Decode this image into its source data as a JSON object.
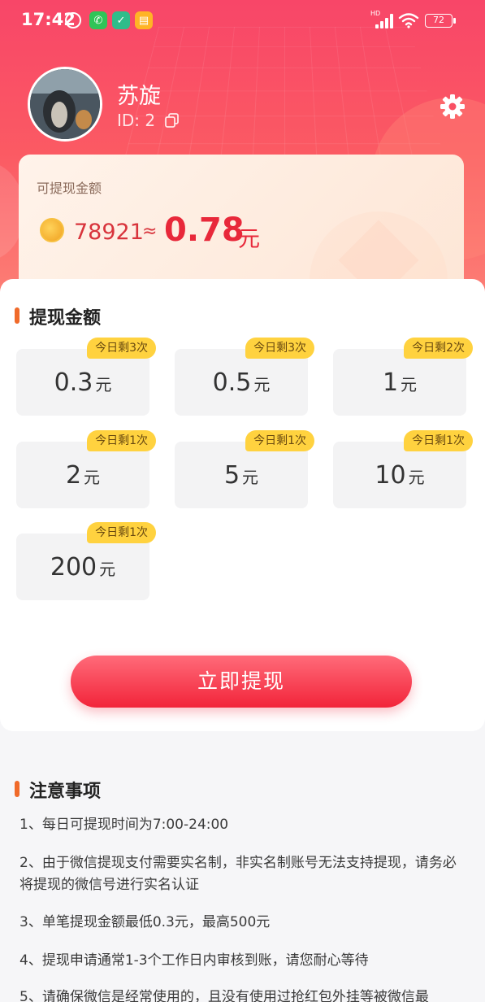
{
  "status_bar": {
    "time": "17:42",
    "network": "HD",
    "battery": "72"
  },
  "profile": {
    "name": "苏旋",
    "id_text": "ID: 2"
  },
  "balance": {
    "label": "可提现金额",
    "coins": "78921",
    "approx": "≈",
    "amount": "0.78",
    "unit": "元"
  },
  "withdraw_section": {
    "title": "提现金额",
    "unit": "元",
    "options": [
      {
        "amount": "0.3",
        "badge": "今日剩3次"
      },
      {
        "amount": "0.5",
        "badge": "今日剩3次"
      },
      {
        "amount": "1",
        "badge": "今日剩2次"
      },
      {
        "amount": "2",
        "badge": "今日剩1次"
      },
      {
        "amount": "5",
        "badge": "今日剩1次"
      },
      {
        "amount": "10",
        "badge": "今日剩1次"
      },
      {
        "amount": "200",
        "badge": "今日剩1次"
      }
    ],
    "button_label": "立即提现"
  },
  "notice": {
    "title": "注意事项",
    "items": [
      "1、每日可提现时间为7:00-24:00",
      "2、由于微信提现支付需要实名制，非实名制账号无法支持提现，请务必将提现的微信号进行实名认证",
      "3、单笔提现金额最低0.3元，最高500元",
      "4、提现申请通常1-3个工作日内审核到账，请您耐心等待",
      "5、请确保微信是经常使用的，且没有使用过抢红包外挂等被微信最"
    ]
  },
  "colors": {
    "header": "#f84668",
    "accent": "#e8283a",
    "badge": "#ffd23f",
    "section_bar": "#f06a2a"
  }
}
